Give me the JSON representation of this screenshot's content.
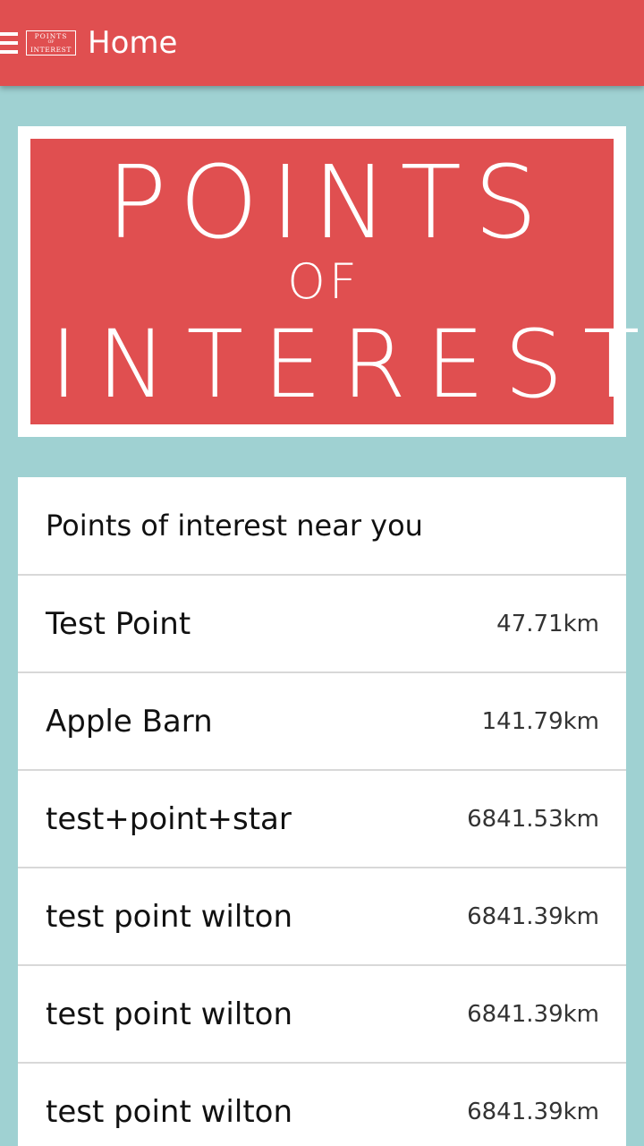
{
  "appbar": {
    "logo_lines": [
      "POINTS",
      "OF",
      "INTEREST"
    ],
    "title": "Home",
    "menu_icon": "hamburger-menu-icon"
  },
  "banner": {
    "line1": "POINTS",
    "line2": "OF",
    "line3": "INTEREST"
  },
  "list": {
    "header": "Points of interest near you",
    "items": [
      {
        "name": "Test Point",
        "distance": "47.71km"
      },
      {
        "name": "Apple Barn",
        "distance": "141.79km"
      },
      {
        "name": "test+point+star",
        "distance": "6841.53km"
      },
      {
        "name": "test point wilton",
        "distance": "6841.39km"
      },
      {
        "name": "test point wilton",
        "distance": "6841.39km"
      },
      {
        "name": "test point wilton",
        "distance": "6841.39km"
      }
    ]
  },
  "colors": {
    "primary": "#e04f50",
    "background": "#9fd1d2",
    "card": "#ffffff"
  }
}
